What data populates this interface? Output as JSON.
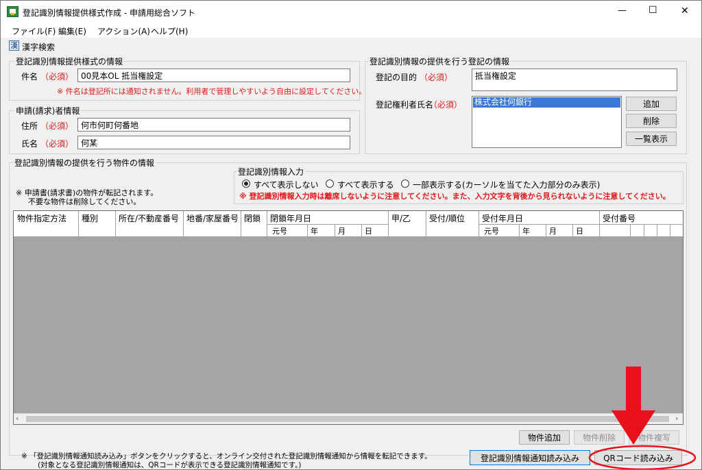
{
  "window": {
    "title": "登記識別情報提供様式作成 - 申請用総合ソフト",
    "minimize": "—",
    "maximize": "☐",
    "close": "✕"
  },
  "menu": [
    "ファイル(F)",
    "編集(E)",
    "アクション(A)",
    "ヘルプ(H)"
  ],
  "toolbar": {
    "kanji_icon": "漢",
    "kanji_search": "漢字検索"
  },
  "form_info": {
    "title": "登記識別情報提供様式の情報",
    "case_label": "件名",
    "required": "（必須）",
    "case_value": "00見本OL  抵当権設定",
    "note": "※  件名は登記所には通知されません。利用者で管理しやすいよう自由に設定してください。"
  },
  "applicant": {
    "title": "申請(請求)者情報",
    "address_label": "住所",
    "address_required": "（必須）",
    "address_value": "何市何町何番地",
    "name_label": "氏名",
    "name_required": "（必須）",
    "name_value": "何某"
  },
  "registration": {
    "title": "登記識別情報の提供を行う登記の情報",
    "purpose_label": "登記の目的",
    "purpose_required": "（必須）",
    "purpose_value": "抵当権設定",
    "holder_label": "登記権利者氏名",
    "holder_required": "（必須）",
    "holder_selected": "株式会社何銀行",
    "add_button": "追加",
    "delete_button": "削除",
    "list_button": "一覧表示"
  },
  "property": {
    "title": "登記識別情報の提供を行う物件の情報",
    "note_line1": "※  申請書(請求書)の物件が転記されます。",
    "note_line2": "不要な物件は削除してください。",
    "input_group_title": "登記識別情報入力",
    "radio_options": [
      "すべて表示しない",
      "すべて表示する",
      "一部表示する(カーソルを当てた入力部分のみ表示)"
    ],
    "selected_radio": 0,
    "warning": "※  登記識別情報入力時は離席しないように注意してください。また、入力文字を背後から見られないように注意してください。"
  },
  "table": {
    "headers": {
      "col1": "物件指定方法",
      "col2": "種別",
      "col3": "所在/不動産番号",
      "col4": "地番/家屋番号",
      "col5": "閉鎖",
      "col6": "閉鎖年月日",
      "col7": "甲/乙",
      "col8": "受付/順位",
      "col9": "受付年月日",
      "col10": "受付番号",
      "sub_era": "元号",
      "sub_year": "年",
      "sub_month": "月",
      "sub_day": "日",
      "sub_era2": "元号",
      "sub_year2": "年",
      "sub_month2": "月",
      "sub_day2": "日"
    },
    "rows": []
  },
  "buttons": {
    "add_property": "物件追加",
    "delete_property": "物件削除",
    "copy_property": "物件複写",
    "import_notice": "登記識別情報通知読み込み",
    "qr_import": "QRコード読み込み"
  },
  "bottom_note": {
    "line1": "※  「登記識別情報通知読み込み」ボタンをクリックすると、オンライン交付された登記識別情報通知から情報を転記できます。",
    "line2": "(対象となる登記識別情報通知は、QRコードが表示できる登記識別情報通知です。)"
  },
  "colors": {
    "annotation_red": "#e8101a",
    "required_red": "#e01818",
    "grid_bg": "#a5a5a5"
  }
}
